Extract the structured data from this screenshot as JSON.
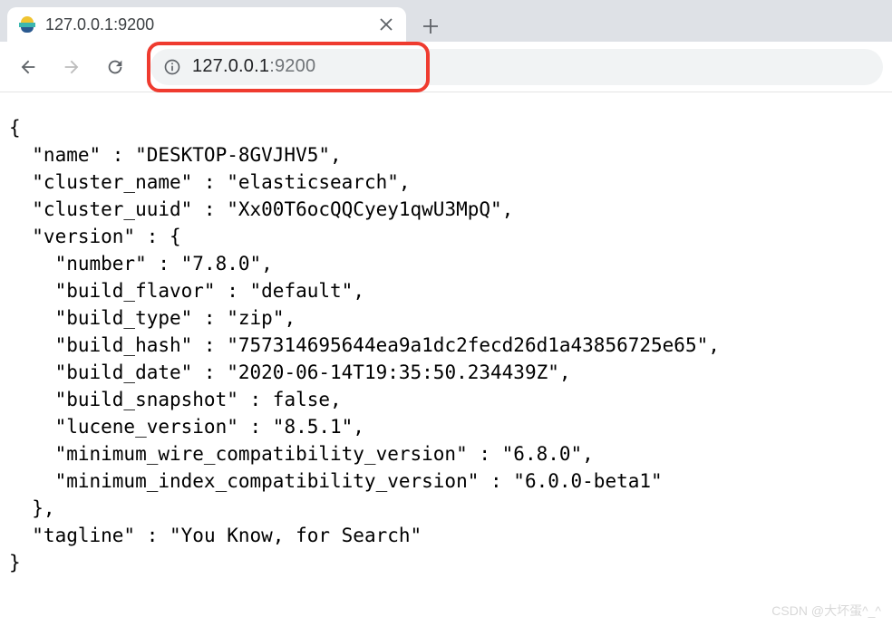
{
  "tab": {
    "title": "127.0.0.1:9200"
  },
  "address": {
    "host": "127.0.0.1",
    "port": ":9200"
  },
  "response": {
    "name": "DESKTOP-8GVJHV5",
    "cluster_name": "elasticsearch",
    "cluster_uuid": "Xx00T6ocQQCyey1qwU3MpQ",
    "version": {
      "number": "7.8.0",
      "build_flavor": "default",
      "build_type": "zip",
      "build_hash": "757314695644ea9a1dc2fecd26d1a43856725e65",
      "build_date": "2020-06-14T19:35:50.234439Z",
      "build_snapshot": "false",
      "lucene_version": "8.5.1",
      "minimum_wire_compatibility_version": "6.8.0",
      "minimum_index_compatibility_version": "6.0.0-beta1"
    },
    "tagline": "You Know, for Search"
  },
  "watermark": "CSDN @大坏蛋^_^"
}
